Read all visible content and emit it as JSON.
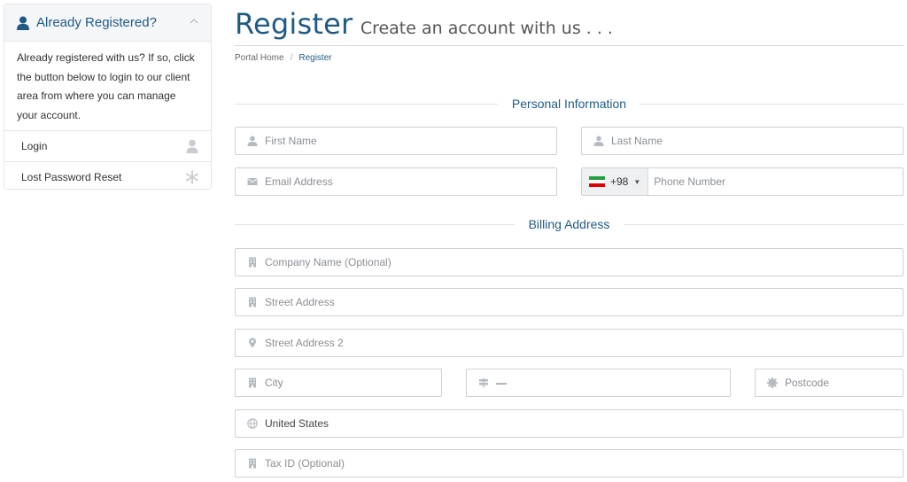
{
  "sidebar": {
    "title": "Already Registered?",
    "body": "Already registered with us? If so, click the button below to login to our client area from where you can manage your account.",
    "items": [
      {
        "label": "Login",
        "icon": "user-icon"
      },
      {
        "label": "Lost Password Reset",
        "icon": "asterisk-icon"
      }
    ]
  },
  "header": {
    "title": "Register",
    "subtitle": "Create an account with us . . ."
  },
  "breadcrumb": {
    "home": "Portal Home",
    "separator": "/",
    "current": "Register"
  },
  "sections": {
    "personal": "Personal Information",
    "billing": "Billing Address"
  },
  "fields": {
    "first_name": {
      "placeholder": "First Name",
      "icon": "user-icon"
    },
    "last_name": {
      "placeholder": "Last Name",
      "icon": "user-icon"
    },
    "email": {
      "placeholder": "Email Address",
      "icon": "envelope-icon"
    },
    "phone": {
      "placeholder": "Phone Number",
      "country_code": "+98",
      "flag": "iran-flag"
    },
    "company": {
      "placeholder": "Company Name (Optional)",
      "icon": "building-icon"
    },
    "street1": {
      "placeholder": "Street Address",
      "icon": "building-icon"
    },
    "street2": {
      "placeholder": "Street Address 2",
      "icon": "map-marker-icon"
    },
    "city": {
      "placeholder": "City",
      "icon": "building-icon"
    },
    "state": {
      "value": "—",
      "icon": "signpost-icon"
    },
    "postcode": {
      "placeholder": "Postcode",
      "icon": "certificate-icon"
    },
    "country": {
      "value": "United States",
      "icon": "globe-icon"
    },
    "tax_id": {
      "placeholder": "Tax ID (Optional)",
      "icon": "building-icon"
    }
  },
  "colors": {
    "accent": "#1f5a85",
    "border": "#ccd1d6",
    "icon": "#b5bbc1"
  }
}
